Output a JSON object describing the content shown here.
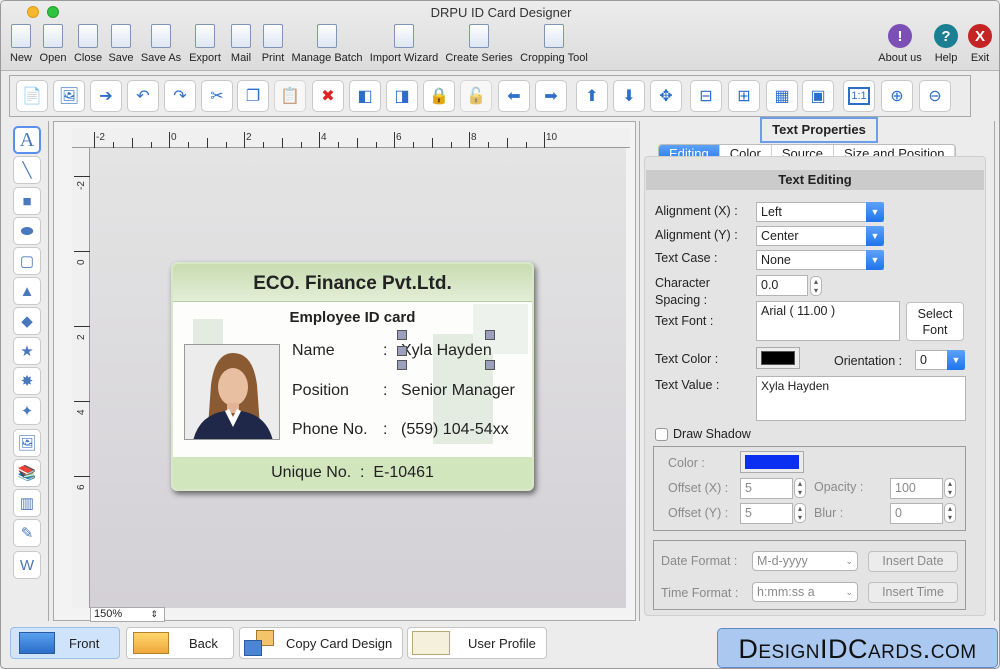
{
  "window": {
    "title": "DRPU ID Card Designer"
  },
  "main_toolbar": {
    "items": [
      {
        "label": "New",
        "icon": "new-document-icon"
      },
      {
        "label": "Open",
        "icon": "open-folder-icon"
      },
      {
        "label": "Close",
        "icon": "close-document-icon"
      },
      {
        "label": "Save",
        "icon": "save-icon"
      },
      {
        "label": "Save As",
        "icon": "save-as-icon"
      },
      {
        "label": "Export",
        "icon": "export-icon"
      },
      {
        "label": "Mail",
        "icon": "mail-icon"
      },
      {
        "label": "Print",
        "icon": "print-icon"
      },
      {
        "label": "Manage Batch",
        "icon": "manage-batch-icon"
      },
      {
        "label": "Import Wizard",
        "icon": "import-wizard-icon"
      },
      {
        "label": "Create Series",
        "icon": "create-series-icon"
      },
      {
        "label": "Cropping Tool",
        "icon": "crop-icon"
      }
    ],
    "right_items": [
      {
        "label": "About us",
        "icon": "info-icon",
        "glyph": "!",
        "color": "#7b4fb5"
      },
      {
        "label": "Help",
        "icon": "help-icon",
        "glyph": "?",
        "color": "#1c7e92"
      },
      {
        "label": "Exit",
        "icon": "exit-icon",
        "glyph": "X",
        "color": "#c42424"
      }
    ]
  },
  "edit_toolbar": {
    "items": [
      {
        "name": "properties",
        "glyph": "📄"
      },
      {
        "name": "background-image",
        "glyph": "🖼"
      },
      {
        "name": "import-image",
        "glyph": "➔"
      },
      {
        "name": "undo",
        "glyph": "↶"
      },
      {
        "name": "redo",
        "glyph": "↷"
      },
      {
        "name": "cut",
        "glyph": "✂"
      },
      {
        "name": "copy",
        "glyph": "❐"
      },
      {
        "name": "paste",
        "glyph": "📋"
      },
      {
        "name": "delete",
        "glyph": "✖"
      },
      {
        "name": "bring-to-front",
        "glyph": "◧"
      },
      {
        "name": "send-to-back",
        "glyph": "◨"
      },
      {
        "name": "lock",
        "glyph": "🔒"
      },
      {
        "name": "unlock",
        "glyph": "🔓"
      },
      {
        "name": "move-left",
        "glyph": "⬅"
      },
      {
        "name": "move-right",
        "glyph": "➡"
      },
      {
        "name": "move-up",
        "glyph": "⬆"
      },
      {
        "name": "move-down",
        "glyph": "⬇"
      },
      {
        "name": "center",
        "glyph": "✥"
      },
      {
        "name": "align-horizontal-center",
        "glyph": "⊟"
      },
      {
        "name": "align-vertical-center",
        "glyph": "⊞"
      },
      {
        "name": "grid",
        "glyph": "▦"
      },
      {
        "name": "ruler",
        "glyph": "▣"
      },
      {
        "name": "actual-size",
        "glyph": "1:1"
      },
      {
        "name": "zoom-in",
        "glyph": "⊕"
      },
      {
        "name": "zoom-out",
        "glyph": "⊖"
      }
    ]
  },
  "left_tools": [
    {
      "name": "text-tool",
      "glyph": "A",
      "selected": true
    },
    {
      "name": "line-tool",
      "glyph": "╲"
    },
    {
      "name": "rectangle-tool",
      "glyph": "■"
    },
    {
      "name": "ellipse-tool",
      "glyph": "⬬"
    },
    {
      "name": "rounded-rectangle-tool",
      "glyph": "▢"
    },
    {
      "name": "triangle-tool",
      "glyph": "▲"
    },
    {
      "name": "diamond-tool",
      "glyph": "◆"
    },
    {
      "name": "star-tool",
      "glyph": "★"
    },
    {
      "name": "burst-tool",
      "glyph": "✸"
    },
    {
      "name": "four-point-star-tool",
      "glyph": "✦"
    },
    {
      "name": "image-tool",
      "glyph": "🖼"
    },
    {
      "name": "library-tool",
      "glyph": "📚"
    },
    {
      "name": "barcode-tool",
      "glyph": "▥"
    },
    {
      "name": "signature-tool",
      "glyph": "✎"
    },
    {
      "name": "watermark-tool",
      "glyph": "W"
    }
  ],
  "canvas": {
    "h_ruler": [
      "-2",
      "0",
      "2",
      "4",
      "6",
      "8",
      "10"
    ],
    "v_ruler": [
      "-2",
      "0",
      "2",
      "4",
      "6"
    ],
    "zoom": "150%"
  },
  "card": {
    "company": "ECO. Finance Pvt.Ltd.",
    "subtitle": "Employee ID card",
    "fields": [
      {
        "label": "Name",
        "value": "Xyla Hayden"
      },
      {
        "label": "Position",
        "value": "Senior Manager"
      },
      {
        "label": "Phone No.",
        "value": "(559) 104-54xx"
      }
    ],
    "footer_label": "Unique No.",
    "footer_value": "E-10461",
    "separator": ":"
  },
  "properties": {
    "title": "Text Properties",
    "tabs": [
      "Editing",
      "Color",
      "Source",
      "Size and Position"
    ],
    "active_tab": "Editing",
    "section": "Text Editing",
    "alignment_x_label": "Alignment (X) :",
    "alignment_x": "Left",
    "alignment_y_label": "Alignment (Y) :",
    "alignment_y": "Center",
    "text_case_label": "Text Case :",
    "text_case": "None",
    "char_spacing_label_1": "Character",
    "char_spacing_label_2": "Spacing :",
    "char_spacing": "0.0",
    "text_font_label": "Text Font :",
    "text_font": "Arial ( 11.00 )",
    "select_font": "Select Font",
    "text_color_label": "Text Color :",
    "text_color": "#000000",
    "orientation_label": "Orientation :",
    "orientation": "0",
    "text_value_label": "Text Value :",
    "text_value": "Xyla Hayden",
    "draw_shadow_label": "Draw Shadow",
    "draw_shadow": false,
    "shadow": {
      "color_label": "Color :",
      "color": "#0a2ff0",
      "offset_x_label": "Offset (X) :",
      "offset_x": "5",
      "offset_y_label": "Offset (Y) :",
      "offset_y": "5",
      "opacity_label": "Opacity :",
      "opacity": "100",
      "blur_label": "Blur :",
      "blur": "0"
    },
    "date_format_label": "Date Format :",
    "date_format": "M-d-yyyy",
    "insert_date": "Insert Date",
    "time_format_label": "Time Format :",
    "time_format": "h:mm:ss a",
    "insert_time": "Insert Time"
  },
  "bottom": {
    "front": "Front",
    "back": "Back",
    "copy_card_design": "Copy Card Design",
    "user_profile": "User Profile",
    "brand": "DesignIDCards.com"
  }
}
